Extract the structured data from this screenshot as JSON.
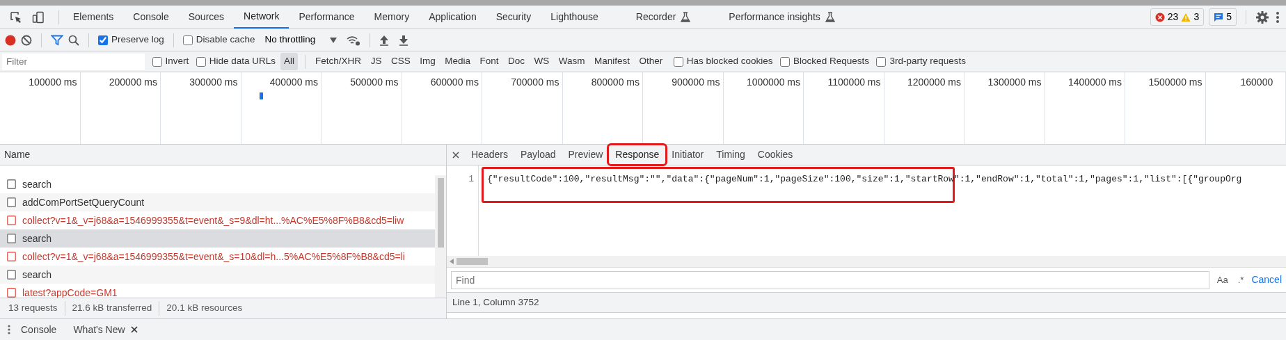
{
  "main_tabs": [
    {
      "label": "Elements",
      "selected": false,
      "experimental": false
    },
    {
      "label": "Console",
      "selected": false,
      "experimental": false
    },
    {
      "label": "Sources",
      "selected": false,
      "experimental": false
    },
    {
      "label": "Network",
      "selected": true,
      "experimental": false
    },
    {
      "label": "Performance",
      "selected": false,
      "experimental": false
    },
    {
      "label": "Memory",
      "selected": false,
      "experimental": false
    },
    {
      "label": "Application",
      "selected": false,
      "experimental": false
    },
    {
      "label": "Security",
      "selected": false,
      "experimental": false
    },
    {
      "label": "Lighthouse",
      "selected": false,
      "experimental": false
    },
    {
      "label": "Recorder",
      "selected": false,
      "experimental": true
    },
    {
      "label": "Performance insights",
      "selected": false,
      "experimental": true
    }
  ],
  "issue_counts": {
    "errors": "23",
    "warnings": "3",
    "messages": "5"
  },
  "toolbar": {
    "recording": true,
    "options": [
      {
        "label": "Preserve log",
        "checked": true
      },
      {
        "label": "Disable cache",
        "checked": false
      }
    ],
    "throttling": "No throttling"
  },
  "filter": {
    "placeholder": "Filter",
    "options": [
      {
        "label": "Invert",
        "checked": false
      },
      {
        "label": "Hide data URLs",
        "checked": false
      }
    ],
    "types": [
      {
        "label": "All",
        "selected": true
      },
      {
        "label": "Fetch/XHR",
        "selected": false
      },
      {
        "label": "JS",
        "selected": false
      },
      {
        "label": "CSS",
        "selected": false
      },
      {
        "label": "Img",
        "selected": false
      },
      {
        "label": "Media",
        "selected": false
      },
      {
        "label": "Font",
        "selected": false
      },
      {
        "label": "Doc",
        "selected": false
      },
      {
        "label": "WS",
        "selected": false
      },
      {
        "label": "Wasm",
        "selected": false
      },
      {
        "label": "Manifest",
        "selected": false
      },
      {
        "label": "Other",
        "selected": false
      }
    ],
    "extra_options": [
      {
        "label": "Has blocked cookies",
        "checked": false
      },
      {
        "label": "Blocked Requests",
        "checked": false
      },
      {
        "label": "3rd-party requests",
        "checked": false
      }
    ]
  },
  "timeline": {
    "ticks": [
      "100000 ms",
      "200000 ms",
      "300000 ms",
      "400000 ms",
      "500000 ms",
      "600000 ms",
      "700000 ms",
      "800000 ms",
      "900000 ms",
      "1000000 ms",
      "1100000 ms",
      "1200000 ms",
      "1300000 ms",
      "1400000 ms",
      "1500000 ms",
      "160000"
    ]
  },
  "requests": {
    "column": "Name",
    "rows": [
      {
        "name": "search",
        "failed": false,
        "selected": false
      },
      {
        "name": "addComPortSetQueryCount",
        "failed": false,
        "selected": false
      },
      {
        "name": "collect?v=1&_v=j68&a=1546999355&t=event&_s=9&dl=ht...%AC%E5%8F%B8&cd5=liw",
        "failed": true,
        "selected": false
      },
      {
        "name": "search",
        "failed": false,
        "selected": true
      },
      {
        "name": "collect?v=1&_v=j68&a=1546999355&t=event&_s=10&dl=h...5%AC%E5%8F%B8&cd5=li",
        "failed": true,
        "selected": false
      },
      {
        "name": "search",
        "failed": false,
        "selected": false
      },
      {
        "name": "latest?appCode=GM1",
        "failed": true,
        "selected": false
      }
    ]
  },
  "summary": [
    "13 requests",
    "21.6 kB transferred",
    "20.1 kB resources"
  ],
  "detail": {
    "tabs": [
      {
        "label": "Headers",
        "selected": false,
        "highlighted": false
      },
      {
        "label": "Payload",
        "selected": false,
        "highlighted": false
      },
      {
        "label": "Preview",
        "selected": false,
        "highlighted": false
      },
      {
        "label": "Response",
        "selected": true,
        "highlighted": true
      },
      {
        "label": "Initiator",
        "selected": false,
        "highlighted": false
      },
      {
        "label": "Timing",
        "selected": false,
        "highlighted": false
      },
      {
        "label": "Cookies",
        "selected": false,
        "highlighted": false
      }
    ],
    "response": {
      "lines": [
        {
          "number": "1",
          "text": "{\"resultCode\":100,\"resultMsg\":\"\",\"data\":{\"pageNum\":1,\"pageSize\":100,\"size\":1,\"startRow\":1,\"endRow\":1,\"total\":1,\"pages\":1,\"list\":[{\"groupOrg",
          "highlighted": true
        }
      ]
    },
    "find": {
      "placeholder": "Find",
      "buttons": [
        "Aa",
        ".*"
      ],
      "cancel": "Cancel"
    },
    "status": "Line 1, Column 3752"
  },
  "drawer": {
    "tabs": [
      {
        "label": "Console",
        "closable": false
      },
      {
        "label": "What's New",
        "closable": true
      }
    ]
  }
}
